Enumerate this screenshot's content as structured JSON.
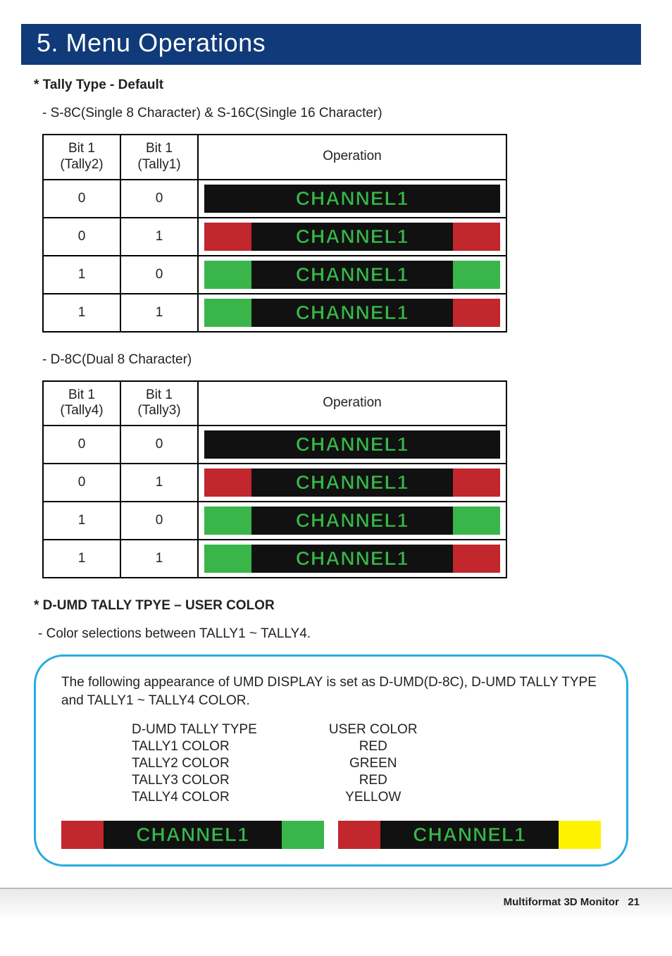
{
  "header": {
    "title": "5. Menu Operations"
  },
  "section1": {
    "heading": "* Tally Type - Default",
    "note": "- S-8C(Single 8 Character)  & S-16C(Single 16 Character)",
    "table": {
      "col1": "Bit 1\n(Tally2)",
      "col2": "Bit 1\n(Tally1)",
      "col3": "Operation",
      "rows": [
        {
          "b1": "0",
          "b2": "0",
          "left": "black",
          "right": "black",
          "label": "CHANNEL1"
        },
        {
          "b1": "0",
          "b2": "1",
          "left": "red",
          "right": "red",
          "label": "CHANNEL1"
        },
        {
          "b1": "1",
          "b2": "0",
          "left": "green",
          "right": "green",
          "label": "CHANNEL1"
        },
        {
          "b1": "1",
          "b2": "1",
          "left": "green",
          "right": "red",
          "label": "CHANNEL1"
        }
      ]
    }
  },
  "section2": {
    "note": "- D-8C(Dual 8 Character)",
    "table": {
      "col1": "Bit 1\n(Tally4)",
      "col2": "Bit 1\n(Tally3)",
      "col3": "Operation",
      "rows": [
        {
          "b1": "0",
          "b2": "0",
          "left": "black",
          "right": "black",
          "label": "CHANNEL1"
        },
        {
          "b1": "0",
          "b2": "1",
          "left": "red",
          "right": "red",
          "label": "CHANNEL1"
        },
        {
          "b1": "1",
          "b2": "0",
          "left": "green",
          "right": "green",
          "label": "CHANNEL1"
        },
        {
          "b1": "1",
          "b2": "1",
          "left": "green",
          "right": "red",
          "label": "CHANNEL1"
        }
      ]
    }
  },
  "section3": {
    "heading": "* D-UMD TALLY TPYE – USER COLOR",
    "note": "- Color selections between TALLY1 ~ TALLY4.",
    "callout": {
      "intro": "The following appearance of UMD DISPLAY is set as D-UMD(D-8C), D-UMD TALLY TYPE and TALLY1 ~ TALLY4 COLOR.",
      "settings": {
        "labels": [
          "D-UMD TALLY TYPE",
          "TALLY1 COLOR",
          "TALLY2 COLOR",
          "TALLY3 COLOR",
          "TALLY4 COLOR"
        ],
        "values": [
          "USER COLOR",
          "RED",
          "GREEN",
          "RED",
          "YELLOW"
        ]
      },
      "bars": [
        {
          "left": "red",
          "right": "green",
          "label": "CHANNEL1"
        },
        {
          "left": "red",
          "right": "yellow",
          "label": "CHANNEL1"
        }
      ]
    }
  },
  "footer": {
    "title": "Multiformat 3D Monitor",
    "page": "21"
  },
  "colors": {
    "red": "#c1272d",
    "green": "#39b54a",
    "yellow": "#fff200",
    "black": "#111"
  }
}
